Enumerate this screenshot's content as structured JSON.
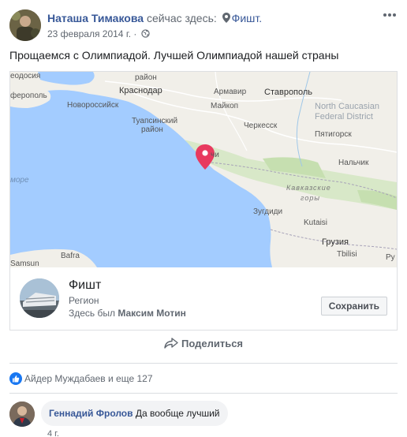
{
  "post": {
    "author": "Наташа Тимакова",
    "checkin_text": "сейчас здесь:",
    "place_link": "Фишт.",
    "date": "23 февраля 2014 г.",
    "separator": "·",
    "text": "Прощаемся с Олимпиадой. Лучшей Олимпиадой нашей страны"
  },
  "map": {
    "labels": {
      "rayon": "район",
      "feodosia": "еодосия",
      "krasnodar": "Краснодар",
      "armavir": "Армавир",
      "stavropol": "Ставрополь",
      "feropol": "ферополь",
      "novorossiysk": "Новороссийск",
      "maykop": "Майкоп",
      "tuapse_1": "Туапсинский",
      "tuapse_2": "район",
      "cherkessk": "Черкесск",
      "pyatigorsk": "Пятигорск",
      "nfd_1": "North Caucasian",
      "nfd_2": "Federal District",
      "sochi": "чи",
      "nalchik": "Нальчик",
      "more": "море",
      "kavkaz_1": "Кавказские",
      "kavkaz_2": "горы",
      "zugdidi": "Зугдиди",
      "kutaisi": "Kutaisi",
      "gruzia": "Грузия",
      "bafra": "Bafra",
      "samsun": "Samsun",
      "tbilisi": "Tbilisi",
      "ru": "Ру"
    }
  },
  "place": {
    "name": "Фишт",
    "type": "Регион",
    "visited_prefix": "Здесь был",
    "visited_by": "Максим Мотин",
    "save_label": "Сохранить"
  },
  "actions": {
    "share_label": "Поделиться"
  },
  "reactions": {
    "text": "Айдер Муждабаев и еще 127"
  },
  "comment": {
    "author": "Геннадий Фролов",
    "text": "Да вообще лучший",
    "time": "4 г."
  },
  "colors": {
    "link": "#385898",
    "secondary": "#606770",
    "sea": "#a3ccff",
    "land": "#f1efe9",
    "pin": "#e8395f",
    "like": "#1877f2"
  },
  "icons": {
    "pin": "map-pin-icon",
    "privacy": "globe-icon",
    "more": "more-options-icon",
    "share": "share-arrow-icon",
    "like": "thumbs-up-icon"
  }
}
